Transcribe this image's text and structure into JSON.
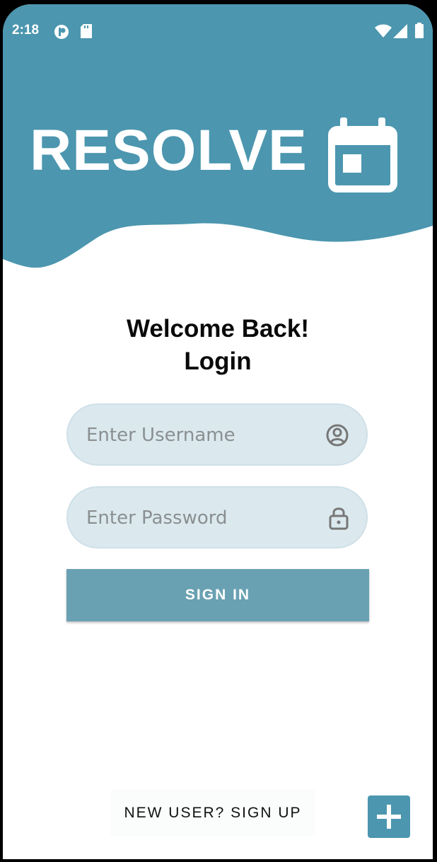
{
  "status_bar": {
    "time": "2:18",
    "icons": [
      "notification-icon",
      "sd-card-icon",
      "wifi-icon",
      "signal-icon",
      "battery-icon"
    ]
  },
  "brand": {
    "name": "RESOLVE",
    "icon": "calendar-icon"
  },
  "login": {
    "title_line1": "Welcome Back!",
    "title_line2": "Login",
    "username_placeholder": "Enter Username",
    "password_placeholder": "Enter Password",
    "username_icon": "user-circle-icon",
    "password_icon": "lock-icon",
    "signin_label": "SIGN IN",
    "signup_label": "NEW USER? SIGN UP",
    "fab_icon": "plus-icon"
  },
  "colors": {
    "header": "#4c96af",
    "field_bg": "#dbe9ee",
    "button": "#69a1b2",
    "fab": "#4c96af"
  }
}
